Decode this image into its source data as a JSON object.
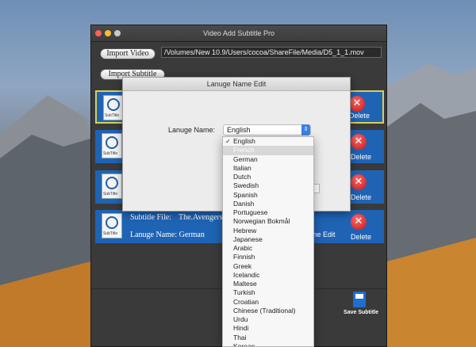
{
  "window": {
    "title": "Video Add Subtitle Pro",
    "import_video_label": "Import Video",
    "import_subtitle_label": "Import Subtitle",
    "video_path": "/Volumes/New 10.9/Users/cocoa/ShareFile/Media/D5_1_1.mov",
    "save_label": "Save Subtitle"
  },
  "rows": [
    {
      "icon_tag": "SubTitle",
      "delete_label": "Delete"
    },
    {
      "icon_tag": "SubTitle",
      "delete_label": "Delete"
    },
    {
      "icon_tag": "SubTitle",
      "delete_label": "Delete"
    },
    {
      "icon_tag": "SubTitle",
      "delete_label": "Delete",
      "subtitle_file_label": "Subtitle File:",
      "subtitle_file_value": "The.Avengers.",
      "language_label": "Lanuge Name: German",
      "edit_label": "me Edit"
    }
  ],
  "dialog": {
    "title": "Lanuge Name Edit",
    "field_label": "Lanuge Name:",
    "selected_value": "English"
  },
  "menu": {
    "checked": "English",
    "highlighted": "French",
    "items": [
      "English",
      "French",
      "German",
      "Italian",
      "Dutch",
      "Swedish",
      "Spanish",
      "Danish",
      "Portuguese",
      "Norwegian Bokmål",
      "Hebrew",
      "Japanese",
      "Arabic",
      "Finnish",
      "Greek",
      "Icelandic",
      "Maltese",
      "Turkish",
      "Croatian",
      "Chinese (Traditional)",
      "Urdu",
      "Hindi",
      "Thai",
      "Korean"
    ]
  },
  "colors": {
    "row_blue": "#1f63b4",
    "selected_border": "#d8d05a",
    "delete_red": "#c81414",
    "popup_blue": "#3b82e8"
  }
}
